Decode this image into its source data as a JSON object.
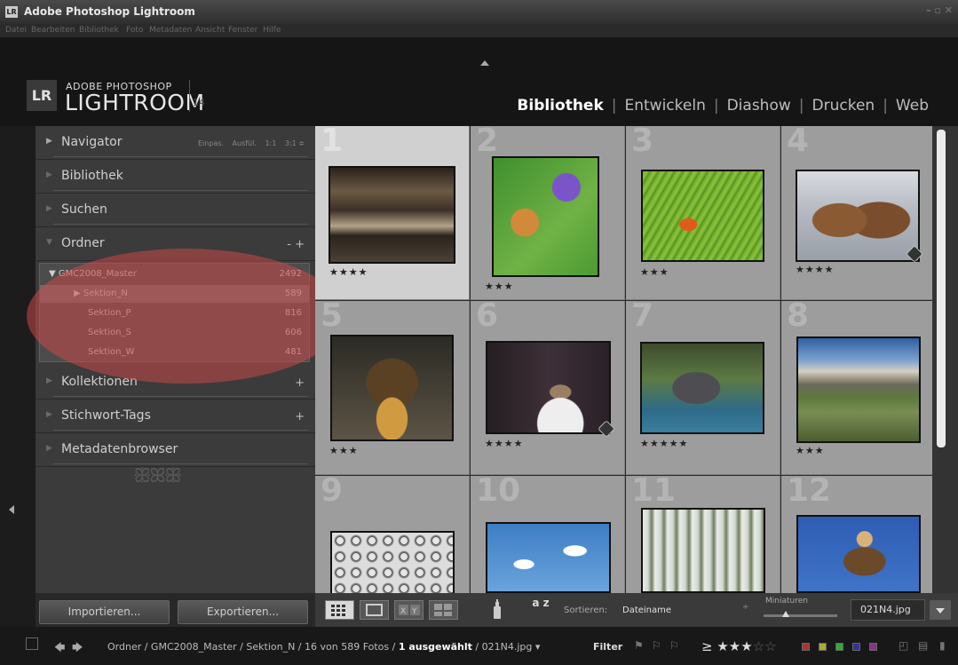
{
  "window": {
    "title": "Adobe Photoshop Lightroom",
    "app_icon_text": "LR",
    "controls": "– ▫ ✕"
  },
  "menu": [
    "Datei",
    "Bearbeiten",
    "Bibliothek",
    "Foto",
    "Metadaten",
    "Ansicht",
    "Fenster",
    "Hilfe"
  ],
  "logo": {
    "badge": "LR",
    "line1": "ADOBE PHOTOSHOP",
    "line2": "LIGHTROOM",
    "version": "14"
  },
  "modules": [
    "Bibliothek",
    "Entwickeln",
    "Diashow",
    "Drucken",
    "Web"
  ],
  "active_module": "Bibliothek",
  "left_panel": {
    "navigator": {
      "label": "Navigator",
      "options": [
        "Einpas.",
        "Ausfül.",
        "1:1",
        "3:1 ≑"
      ]
    },
    "bibliothek": "Bibliothek",
    "suchen": "Suchen",
    "ordner": {
      "label": "Ordner",
      "action": "- +"
    },
    "folder_root": {
      "name": "GMC2008_Master",
      "count": "2492"
    },
    "folders": [
      {
        "name": "Sektion_N",
        "count": "589",
        "selected": true
      },
      {
        "name": "Sektion_P",
        "count": "816",
        "selected": false
      },
      {
        "name": "Sektion_S",
        "count": "606",
        "selected": false
      },
      {
        "name": "Sektion_W",
        "count": "481",
        "selected": false
      }
    ],
    "kollektionen": {
      "label": "Kollektionen",
      "action": "+"
    },
    "stichwort": {
      "label": "Stichwort-Tags",
      "action": "+"
    },
    "metadaten": "Metadatenbrowser",
    "ornament": "ꕥꕤꕥ",
    "import_label": "Importieren...",
    "export_label": "Exportieren..."
  },
  "grid": {
    "cells": [
      {
        "num": "1",
        "stars": "★★★★",
        "selected": true,
        "badge": false,
        "img": "clouds"
      },
      {
        "num": "2",
        "stars": "★★★",
        "selected": false,
        "badge": false,
        "img": "butterfly-flower"
      },
      {
        "num": "3",
        "stars": "★★★",
        "selected": false,
        "badge": false,
        "img": "leaf-butterfly"
      },
      {
        "num": "4",
        "stars": "★★★★",
        "selected": false,
        "badge": true,
        "img": "bears"
      },
      {
        "num": "5",
        "stars": "★★★",
        "selected": false,
        "badge": false,
        "img": "cormorant"
      },
      {
        "num": "6",
        "stars": "★★★★",
        "selected": false,
        "badge": true,
        "img": "lynx"
      },
      {
        "num": "7",
        "stars": "★★★★★",
        "selected": false,
        "badge": false,
        "img": "monkeys"
      },
      {
        "num": "8",
        "stars": "★★★",
        "selected": false,
        "badge": false,
        "img": "landscape"
      },
      {
        "num": "9",
        "stars": "",
        "selected": false,
        "badge": false,
        "img": "seeds"
      },
      {
        "num": "10",
        "stars": "",
        "selected": false,
        "badge": false,
        "img": "birds-flying"
      },
      {
        "num": "11",
        "stars": "",
        "selected": false,
        "badge": false,
        "img": "waterfall"
      },
      {
        "num": "12",
        "stars": "",
        "selected": false,
        "badge": false,
        "img": "vulture"
      }
    ]
  },
  "toolbar": {
    "sort_label": "Sortieren:",
    "sort_value": "Dateiname",
    "sort_arrow": "÷",
    "sort_icon": "a z",
    "thumb_label": "Miniaturen",
    "thumbnail_size": 0.3,
    "file": "021N4.jpg"
  },
  "filmstrip": {
    "crumb_prefix": "Ordner / GMC2008_Master / Sektion_N / 16 von 589 Fotos / ",
    "crumb_selected": "1 ausgewählt",
    "crumb_suffix": " / 021N4.jpg ▾",
    "filter_label": "Filter",
    "rating_op": "≥",
    "stars_on": "★★★",
    "stars_off": "☆☆"
  },
  "colors": {
    "accent_highlight": "#c84848",
    "panel": "#3b3b3b",
    "grid_cell": "#9d9d9d"
  }
}
